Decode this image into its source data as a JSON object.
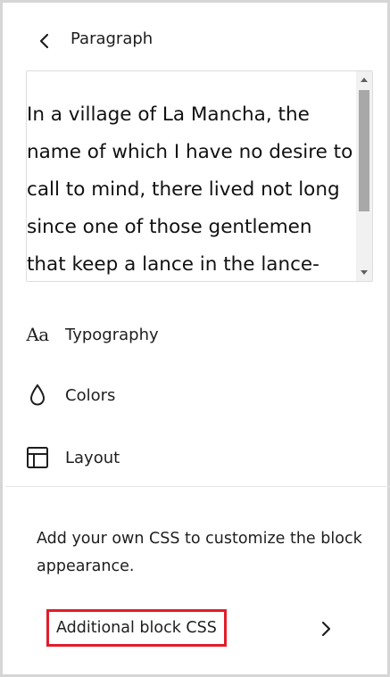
{
  "header": {
    "title": "Paragraph"
  },
  "preview": {
    "lines": [
      "In a village of La Mancha, the",
      "name of which I have no desire to",
      "call to mind, there lived not long",
      "since one of those gentlemen",
      "that keep a lance in the lance-"
    ]
  },
  "menu": {
    "items": [
      {
        "label": "Typography",
        "icon": "typography-icon",
        "icon_text": "Aa"
      },
      {
        "label": "Colors",
        "icon": "droplet-icon"
      },
      {
        "label": "Layout",
        "icon": "layout-icon"
      }
    ]
  },
  "css_panel": {
    "description": "Add your own CSS to customize the block appearance.",
    "button_label": "Additional block CSS",
    "highlight_color": "#e11d2a"
  }
}
